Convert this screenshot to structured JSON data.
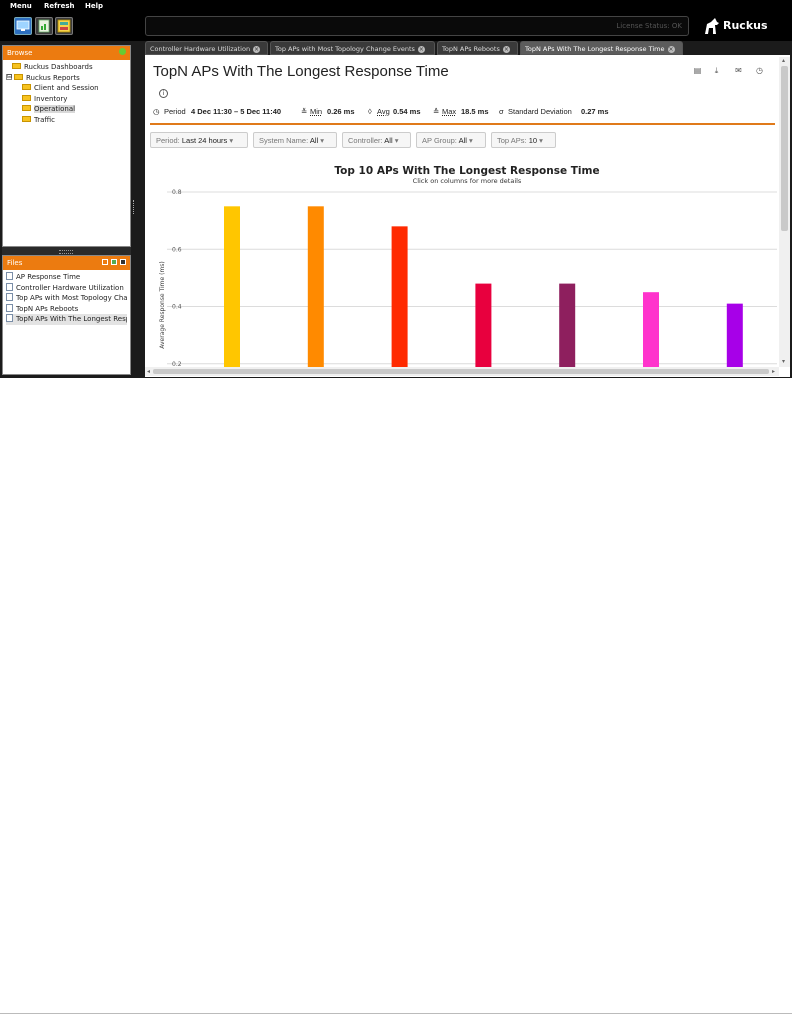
{
  "menu": {
    "items": [
      "Menu",
      "Refresh",
      "Help"
    ]
  },
  "toolbar": {
    "license_status": "License Status: OK",
    "logo_text": "Ruckus",
    "icons": [
      "monitor-icon",
      "report-icon",
      "dashboard-icon"
    ]
  },
  "browse": {
    "title": "Browse",
    "items": [
      {
        "label": "Ruckus Dashboards",
        "indent": 1
      },
      {
        "label": "Ruckus Reports",
        "indent": 0,
        "toggle": "⊟"
      },
      {
        "label": "Client and Session",
        "indent": 2
      },
      {
        "label": "Inventory",
        "indent": 2
      },
      {
        "label": "Operational",
        "indent": 2
      },
      {
        "label": "Traffic",
        "indent": 2
      }
    ]
  },
  "files": {
    "title": "Files",
    "items": [
      "AP Response Time",
      "Controller Hardware Utilization",
      "Top APs with Most Topology Change Events",
      "TopN APs Reboots",
      "TopN APs With The Longest Response Time"
    ]
  },
  "tabs": [
    {
      "label": "Controller Hardware Utilization",
      "active": false
    },
    {
      "label": "Top APs with Most Topology Change Events",
      "active": false
    },
    {
      "label": "TopN APs Reboots",
      "active": false
    },
    {
      "label": "TopN APs With The Longest Response Time",
      "active": true
    }
  ],
  "report": {
    "title": "TopN APs With The Longest Response Time",
    "stats": {
      "period_label": "Period",
      "period_value": "4 Dec 11:30 – 5 Dec 11:40",
      "min_label": "Min",
      "min_value": "0.26 ms",
      "avg_label": "Avg",
      "avg_value": "0.54 ms",
      "max_label": "Max",
      "max_value": "18.5 ms",
      "std_label": "Standard Deviation",
      "std_value": "0.27 ms"
    },
    "filters": [
      {
        "label": "Period:",
        "value": "Last 24 hours"
      },
      {
        "label": "System Name:",
        "value": "All"
      },
      {
        "label": "Controller:",
        "value": "All"
      },
      {
        "label": "AP Group:",
        "value": "All"
      },
      {
        "label": "Top APs:",
        "value": "10"
      }
    ]
  },
  "chart_data": {
    "type": "bar",
    "title": "Top 10 APs With The Longest Response Time",
    "subtitle": "Click on columns for more details",
    "ylabel": "Average Response Time (ms)",
    "ylim": [
      0,
      0.8
    ],
    "yticks": [
      "0.2",
      "0.4",
      "0.6",
      "0.8"
    ],
    "grid": true,
    "values": [
      0.75,
      0.75,
      0.68,
      0.48,
      0.48,
      0.45,
      0.41
    ],
    "colors": [
      "#ffc600",
      "#ff8a00",
      "#ff2a00",
      "#e8003e",
      "#8e1f5e",
      "#ff33cc",
      "#a700e8"
    ]
  }
}
